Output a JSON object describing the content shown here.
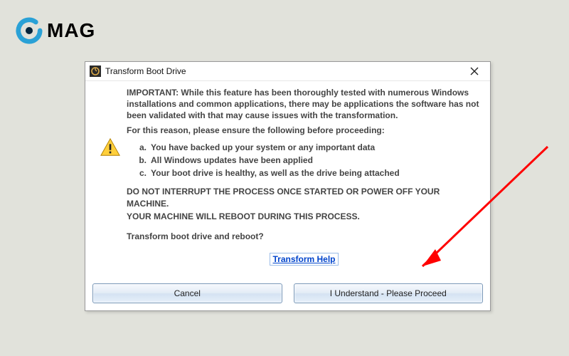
{
  "logo": {
    "text": "MAG"
  },
  "colors": {
    "accent": "#2aa1d6",
    "arrow": "#ff0000",
    "link": "#0044cc"
  },
  "dialog": {
    "title": "Transform Boot Drive",
    "intro": "IMPORTANT: While this feature has been thoroughly tested with numerous Windows installations and common applications, there may be applications the software has not been validated with that may cause issues with the transformation.",
    "ensure": "For this reason, please ensure the following before proceeding:",
    "points": {
      "a_marker": "a.",
      "a": "You have backed up your system or any important data",
      "b_marker": "b.",
      "b": "All Windows updates have been applied",
      "c_marker": "c.",
      "c": "Your boot drive is healthy, as well as the drive being attached"
    },
    "do_not_1": "DO NOT INTERRUPT THE PROCESS ONCE STARTED OR POWER OFF YOUR MACHINE.",
    "do_not_2": "YOUR MACHINE WILL REBOOT DURING THIS PROCESS.",
    "question": "Transform boot drive and reboot?",
    "help_link": "Transform Help",
    "buttons": {
      "cancel": "Cancel",
      "proceed": "I Understand - Please Proceed"
    }
  }
}
